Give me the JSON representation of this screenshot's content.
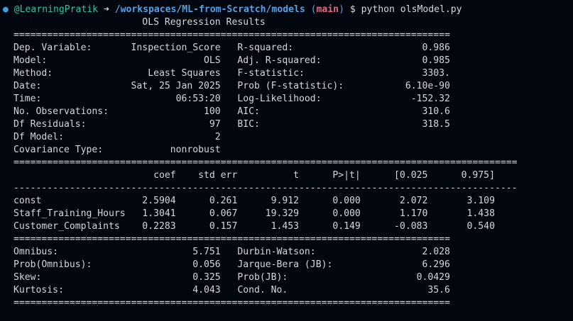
{
  "prompt": {
    "dot": "●",
    "user": "@LearningPratik",
    "arrow": "➜",
    "path": "/workspaces/ML-from-Scratch/models",
    "branch_open": "(",
    "branch": "main",
    "branch_close": ")",
    "dollar": "$",
    "command": "python olsModel.py"
  },
  "output_lines": [
    "                       OLS Regression Results                            ",
    "==============================================================================",
    "Dep. Variable:       Inspection_Score   R-squared:                       0.986",
    "Model:                            OLS   Adj. R-squared:                  0.985",
    "Method:                 Least Squares   F-statistic:                     3303.",
    "Date:                Sat, 25 Jan 2025   Prob (F-statistic):           6.10e-90",
    "Time:                        06:53:20   Log-Likelihood:                -152.32",
    "No. Observations:                 100   AIC:                             310.6",
    "Df Residuals:                      97   BIC:                             318.5",
    "Df Model:                           2                                         ",
    "Covariance Type:            nonrobust                                         ",
    "==========================================================================================",
    "                         coef    std err          t      P>|t|      [0.025      0.975]",
    "------------------------------------------------------------------------------------------",
    "const                  2.5904      0.261      9.912      0.000       2.072       3.109",
    "Staff_Training_Hours   1.3041      0.067     19.329      0.000       1.170       1.438",
    "Customer_Complaints    0.2283      0.157      1.453      0.149      -0.083       0.540",
    "==============================================================================",
    "Omnibus:                        5.751   Durbin-Watson:                   2.028",
    "Prob(Omnibus):                  0.056   Jarque-Bera (JB):                6.296",
    "Skew:                           0.325   Prob(JB):                       0.0429",
    "Kurtosis:                       4.043   Cond. No.                         35.6",
    "=============================================================================="
  ]
}
